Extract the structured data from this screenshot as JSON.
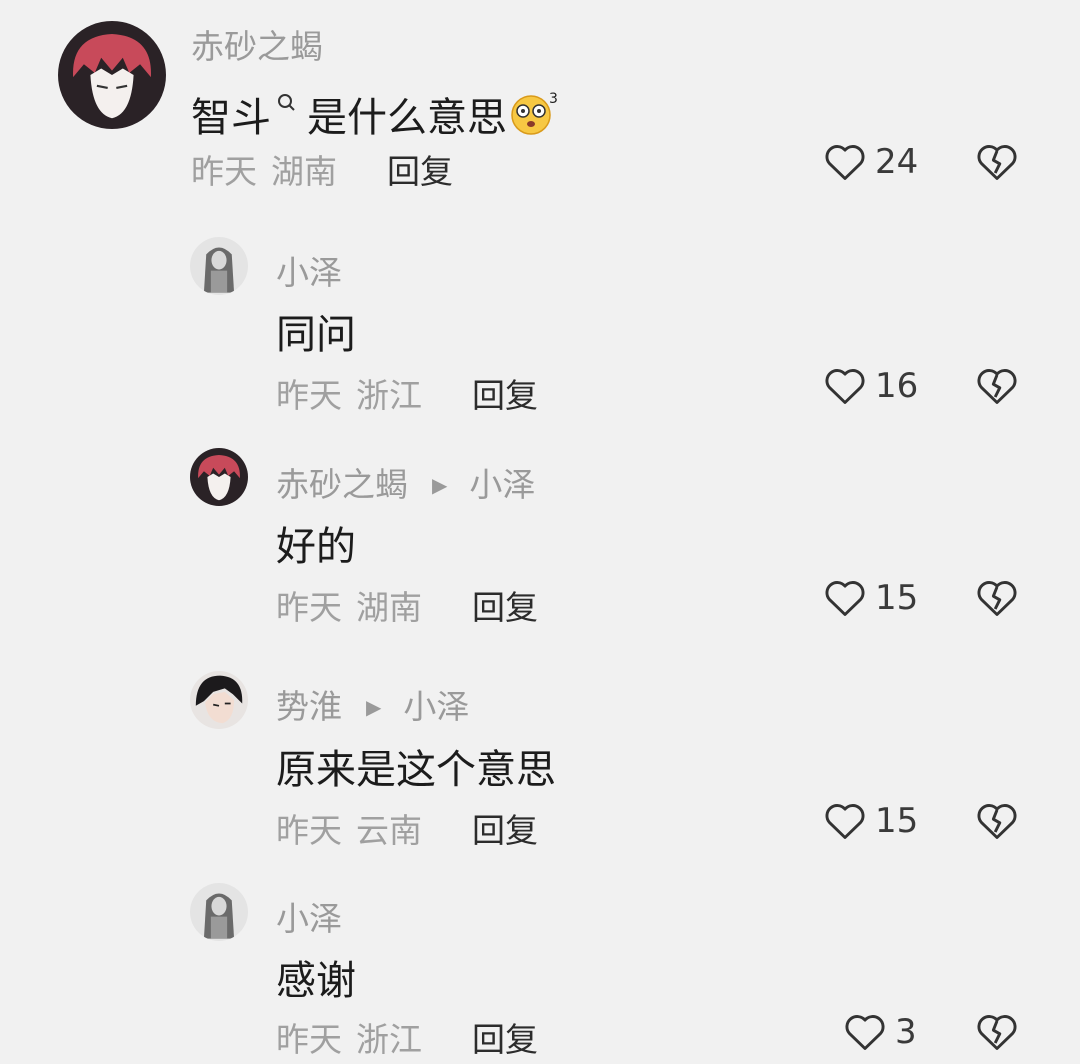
{
  "comments": [
    {
      "username": "赤砂之蝎",
      "reply_to": "",
      "text_before": "智斗",
      "text_after": "是什么意思",
      "emoji": "flushed-face-emoji",
      "time": "昨天",
      "location": "湖南",
      "reply_label": "回复",
      "likes": "24"
    },
    {
      "username": "小泽",
      "reply_to": "",
      "text": "同问",
      "time": "昨天",
      "location": "浙江",
      "reply_label": "回复",
      "likes": "16"
    },
    {
      "username": "赤砂之蝎",
      "reply_to": "小泽",
      "text": "好的",
      "time": "昨天",
      "location": "湖南",
      "reply_label": "回复",
      "likes": "15"
    },
    {
      "username": "势淮",
      "reply_to": "小泽",
      "text": "原来是这个意思",
      "time": "昨天",
      "location": "云南",
      "reply_label": "回复",
      "likes": "15"
    },
    {
      "username": "小泽",
      "reply_to": "",
      "text": "感谢",
      "time": "昨天",
      "location": "浙江",
      "reply_label": "回复",
      "likes": "3"
    }
  ],
  "icons": {
    "like": "heart-icon",
    "dislike": "broken-heart-icon",
    "reply_arrow": "play-arrow-icon",
    "search": "search-icon"
  },
  "colors": {
    "background": "#f1f1f1",
    "username": "#9a9a9a",
    "text": "#1c1c1c",
    "reply": "#2c2c2c"
  }
}
